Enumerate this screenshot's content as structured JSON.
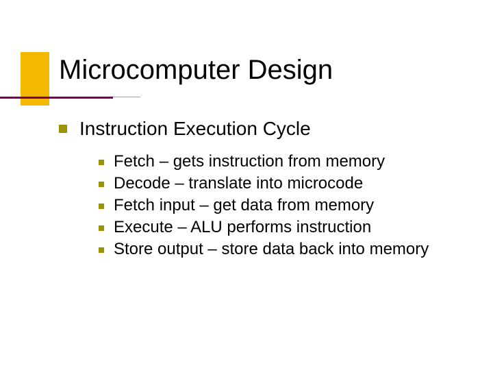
{
  "slide": {
    "title": "Microcomputer Design",
    "lvl1": "Instruction Execution Cycle",
    "items": [
      "Fetch – gets instruction from memory",
      "Decode – translate into microcode",
      "Fetch input – get data from memory",
      "Execute – ALU performs instruction",
      "Store output – store data back into memory"
    ]
  }
}
